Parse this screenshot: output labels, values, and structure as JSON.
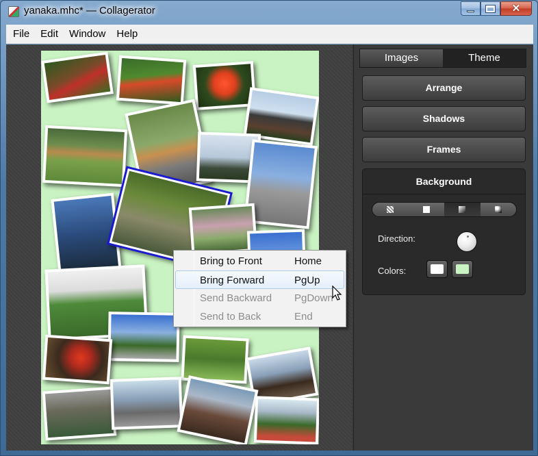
{
  "window": {
    "title": "yanaka.mhc* — Collagerator",
    "controls": {
      "minimize": "minimize-icon",
      "maximize": "maximize-icon",
      "close": "close-icon"
    }
  },
  "menu": [
    "File",
    "Edit",
    "Window",
    "Help"
  ],
  "panel": {
    "tabs": [
      {
        "label": "Images",
        "active": false
      },
      {
        "label": "Theme",
        "active": true
      }
    ],
    "buttons": [
      "Arrange",
      "Shadows",
      "Frames"
    ],
    "background": {
      "title": "Background",
      "styles": [
        "checker-pattern-icon",
        "solid-color-icon",
        "linear-gradient-icon",
        "radial-gradient-icon"
      ],
      "active_style": 2,
      "direction_label": "Direction:",
      "colors_label": "Colors:",
      "colors": [
        "#ffffff",
        "#c9f3c2"
      ]
    }
  },
  "context_menu": [
    {
      "label": "Bring to Front",
      "shortcut": "Home",
      "enabled": true,
      "highlighted": false
    },
    {
      "label": "Bring Forward",
      "shortcut": "PgUp",
      "enabled": true,
      "highlighted": true
    },
    {
      "label": "Send Backward",
      "shortcut": "PgDown",
      "enabled": false,
      "highlighted": false
    },
    {
      "label": "Send to Back",
      "shortcut": "End",
      "enabled": false,
      "highlighted": false
    }
  ],
  "canvas": {
    "background": "#c9f3c2"
  },
  "photos": [
    {
      "subject": "red spider lilies"
    },
    {
      "subject": "red flowers"
    },
    {
      "subject": "red rose"
    },
    {
      "subject": "temple roof"
    },
    {
      "subject": "orange cat on grass"
    },
    {
      "subject": "orange cat on path"
    },
    {
      "subject": "city towers"
    },
    {
      "subject": "tower and buildings"
    },
    {
      "subject": "sky tree at dusk"
    },
    {
      "subject": "garden path"
    },
    {
      "subject": "pink flowers"
    },
    {
      "subject": "blue sky tree"
    },
    {
      "subject": "ivy covered wall"
    },
    {
      "subject": "tree and blue sky"
    },
    {
      "subject": "red lily"
    },
    {
      "subject": "green fruit"
    },
    {
      "subject": "shrine building"
    },
    {
      "subject": "stone carving"
    },
    {
      "subject": "railway yard"
    },
    {
      "subject": "old brick building"
    },
    {
      "subject": "cemetery trees"
    }
  ]
}
